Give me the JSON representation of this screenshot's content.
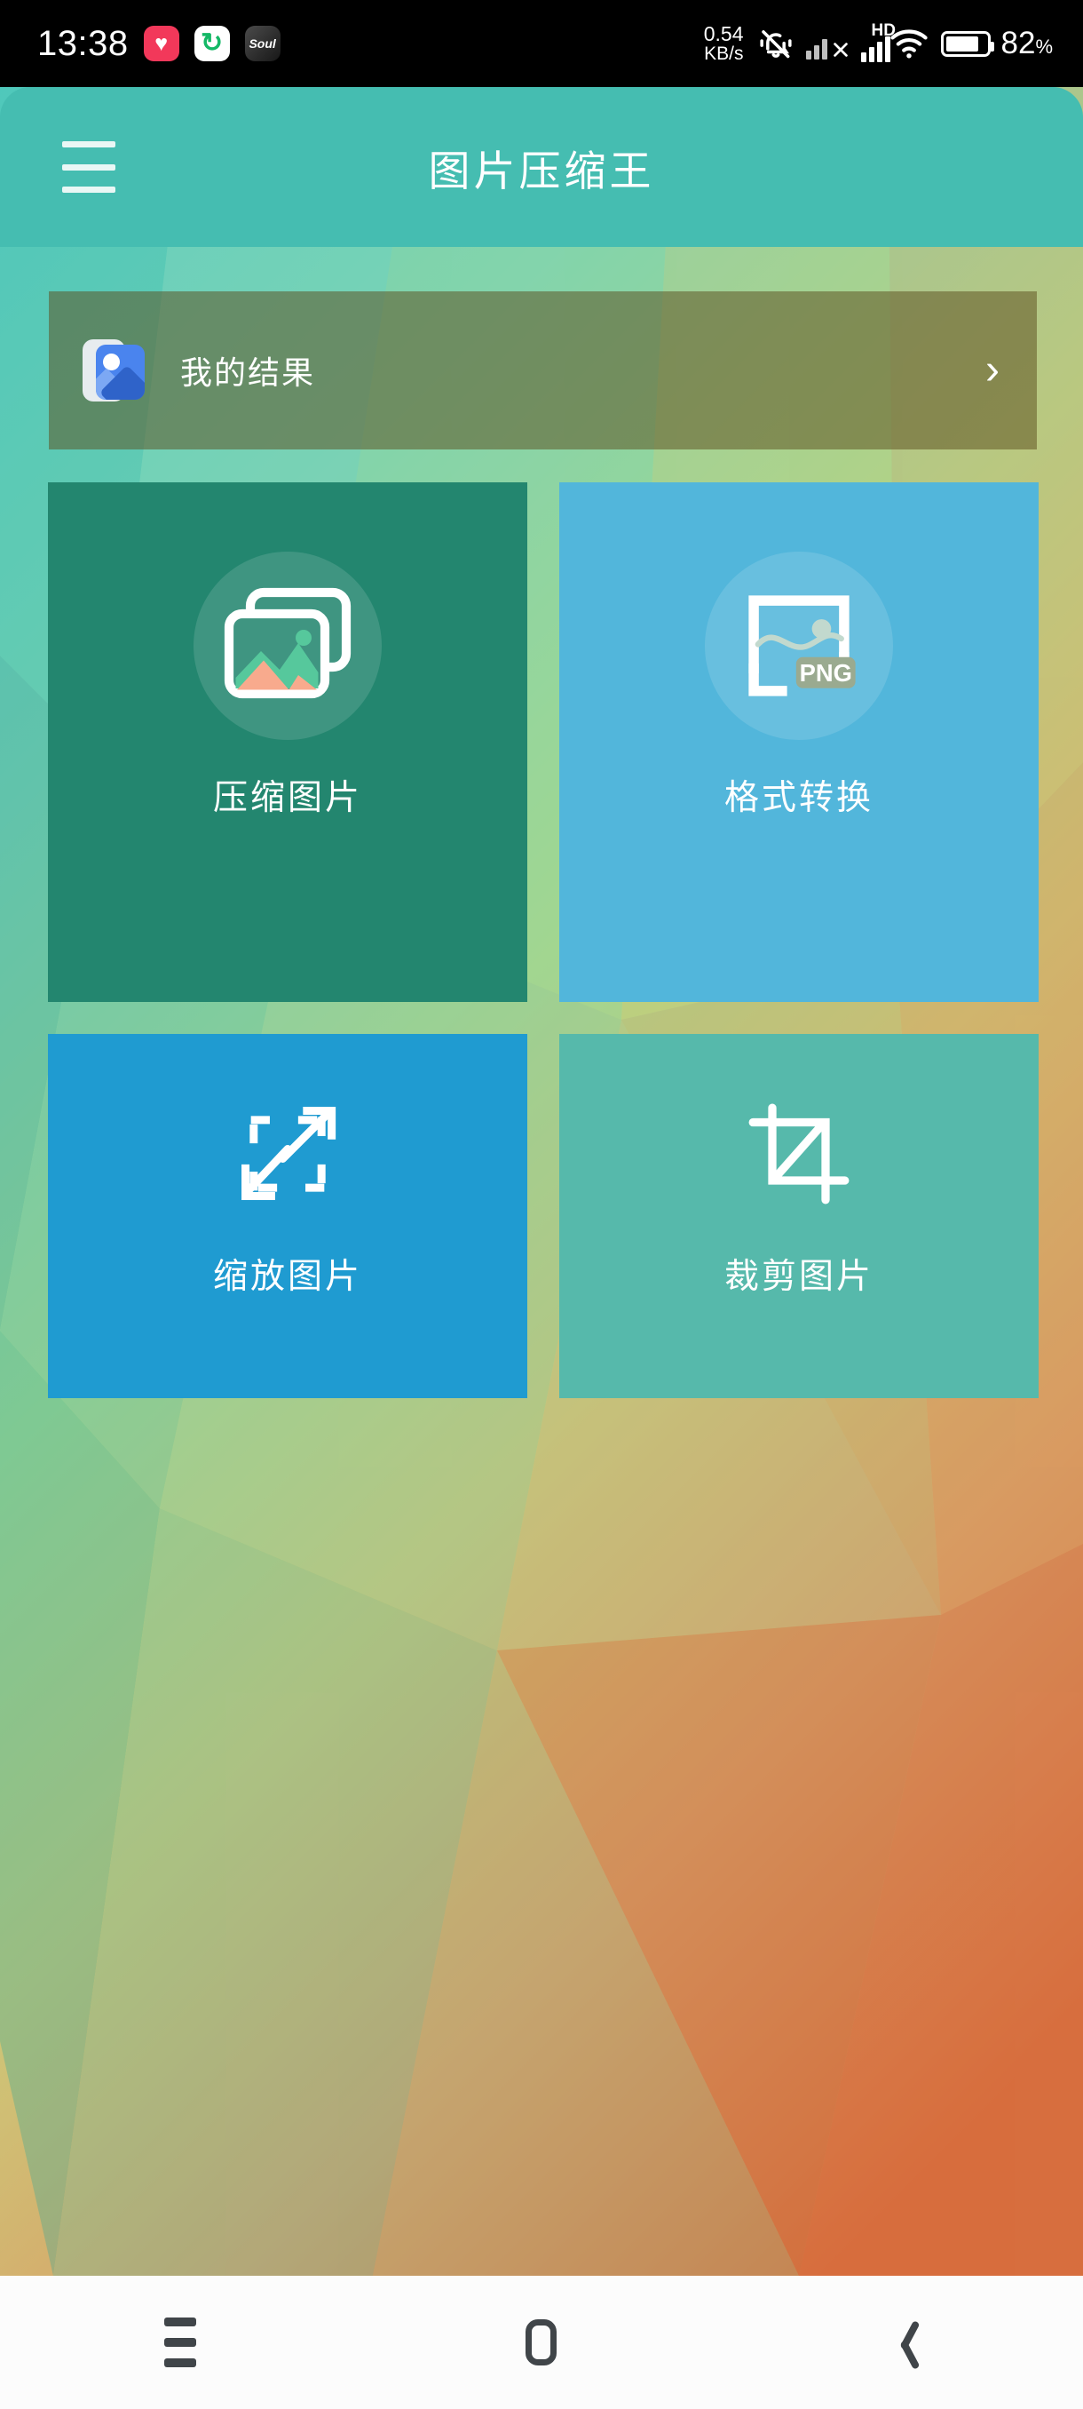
{
  "status_bar": {
    "clock": "13:38",
    "app_icons": [
      {
        "name": "heart-app-icon",
        "glyph": "♥"
      },
      {
        "name": "refresh-app-icon",
        "glyph": "↻"
      },
      {
        "name": "soul-app-icon",
        "glyph": "Soul"
      }
    ],
    "network_speed_value": "0.54",
    "network_speed_unit": "KB/s",
    "mute_icon": "bell-mute-icon",
    "sim_icon": "no-sim-signal-icon",
    "hd_label": "HD",
    "signal_icon": "cellular-signal-icon",
    "wifi_icon": "wifi-icon",
    "battery_percent": "82",
    "battery_percent_symbol": "%",
    "battery_level": 82
  },
  "app_bar": {
    "menu_icon": "hamburger-menu-icon",
    "title": "图片压缩王",
    "background_color": "#45bdb1"
  },
  "results_banner": {
    "icon": "gallery-photos-icon",
    "label": "我的结果",
    "chevron": "›",
    "background_color": "rgba(92,78,30,0.52)"
  },
  "tiles": [
    {
      "id": "compress",
      "label": "压缩图片",
      "icon": "stacked-photos-icon",
      "color": "#23866f"
    },
    {
      "id": "convert",
      "label": "格式转换",
      "icon": "image-format-png-icon",
      "badge": "PNG",
      "color": "#52b6db"
    },
    {
      "id": "resize",
      "label": "缩放图片",
      "icon": "resize-arrows-icon",
      "color": "#1f9bd1"
    },
    {
      "id": "crop",
      "label": "裁剪图片",
      "icon": "crop-tool-icon",
      "color": "#56b9ab"
    }
  ],
  "nav_bar": {
    "recent_icon": "recents-menu-icon",
    "home_icon": "home-square-icon",
    "back_icon": "back-chevron-icon",
    "background_color": "#fcfcfc"
  },
  "wallpaper": {
    "style": "low-poly-triangles",
    "colors": [
      "#5ecfc1",
      "#7fd4b3",
      "#a8d88f",
      "#cdc878",
      "#d8a268",
      "#d9743f"
    ]
  }
}
